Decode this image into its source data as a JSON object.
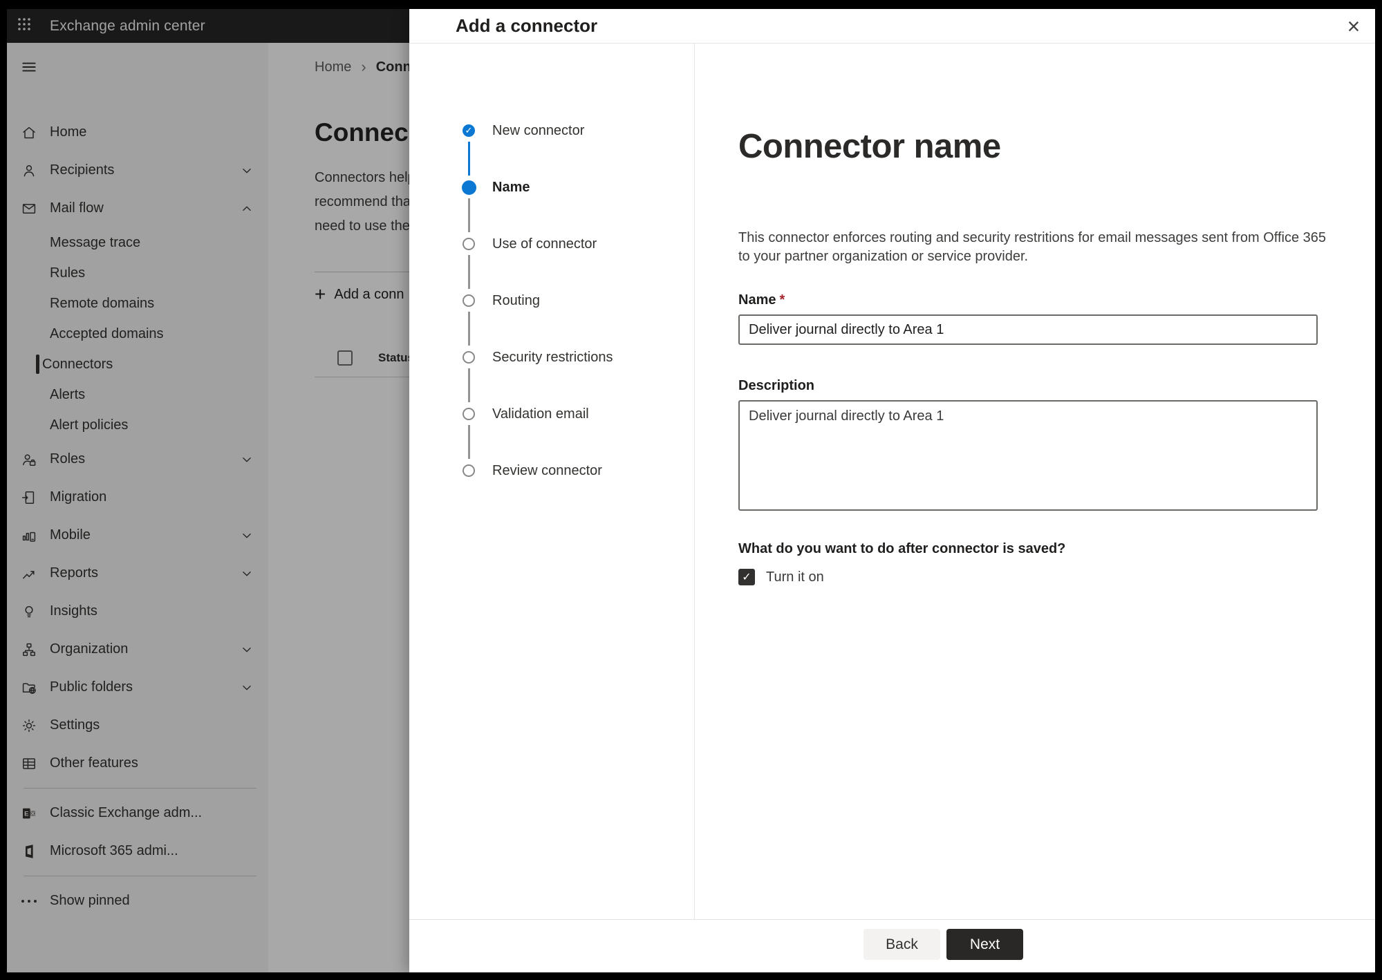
{
  "colors": {
    "accent_blue": "#0b78d4",
    "next_button_bg": "#292827",
    "back_button_bg": "#f3f2f1",
    "required_red": "#a4262c",
    "topbar_bg": "#282726",
    "selected_indicator": "#323130",
    "dim_overlay": "rgba(0,0,0,0.34)"
  },
  "topbar": {
    "app_launcher_icon": "waffle-icon",
    "title": "Exchange admin center"
  },
  "sidebar": {
    "hamburger_icon": "hamburger-icon",
    "items": [
      {
        "label": "Home",
        "icon": "home-icon",
        "type": "top",
        "chevron": null,
        "selected": false
      },
      {
        "label": "Recipients",
        "icon": "person-icon",
        "type": "top",
        "chevron": "down",
        "selected": false
      },
      {
        "label": "Mail flow",
        "icon": "mail-icon",
        "type": "top",
        "chevron": "up",
        "selected": false
      },
      {
        "label": "Message trace",
        "icon": null,
        "type": "sub",
        "chevron": null,
        "selected": false
      },
      {
        "label": "Rules",
        "icon": null,
        "type": "sub",
        "chevron": null,
        "selected": false
      },
      {
        "label": "Remote domains",
        "icon": null,
        "type": "sub",
        "chevron": null,
        "selected": false
      },
      {
        "label": "Accepted domains",
        "icon": null,
        "type": "sub",
        "chevron": null,
        "selected": false
      },
      {
        "label": "Connectors",
        "icon": null,
        "type": "sub",
        "chevron": null,
        "selected": true
      },
      {
        "label": "Alerts",
        "icon": null,
        "type": "sub",
        "chevron": null,
        "selected": false
      },
      {
        "label": "Alert policies",
        "icon": null,
        "type": "sub",
        "chevron": null,
        "selected": false
      },
      {
        "label": "Roles",
        "icon": "roles-icon",
        "type": "top",
        "chevron": "down",
        "selected": false
      },
      {
        "label": "Migration",
        "icon": "migration-icon",
        "type": "top",
        "chevron": null,
        "selected": false
      },
      {
        "label": "Mobile",
        "icon": "mobile-icon",
        "type": "top",
        "chevron": "down",
        "selected": false
      },
      {
        "label": "Reports",
        "icon": "reports-icon",
        "type": "top",
        "chevron": "down",
        "selected": false
      },
      {
        "label": "Insights",
        "icon": "insights-icon",
        "type": "top",
        "chevron": null,
        "selected": false
      },
      {
        "label": "Organization",
        "icon": "organization-icon",
        "type": "top",
        "chevron": "down",
        "selected": false
      },
      {
        "label": "Public folders",
        "icon": "public-folders-icon",
        "type": "top",
        "chevron": "down",
        "selected": false
      },
      {
        "label": "Settings",
        "icon": "settings-icon",
        "type": "top",
        "chevron": null,
        "selected": false
      },
      {
        "label": "Other features",
        "icon": "other-features-icon",
        "type": "top",
        "chevron": null,
        "selected": false
      }
    ],
    "footer_items": [
      {
        "label": "Classic Exchange adm...",
        "icon": "classic-exchange-icon"
      },
      {
        "label": "Microsoft 365 admi...",
        "icon": "m365-icon"
      }
    ],
    "show_pinned": {
      "label": "Show pinned",
      "icon": "ellipsis-icon"
    }
  },
  "page": {
    "breadcrumb": {
      "home": "Home",
      "separator": "›",
      "current": "Conne"
    },
    "title": "Connec",
    "description_lines": [
      "Connectors help",
      "recommend tha",
      "need to use ther"
    ],
    "toolbar": {
      "add_icon": "plus-icon",
      "add_label": "Add a conn"
    },
    "table": {
      "status_header": "Status"
    }
  },
  "modal": {
    "title": "Add a connector",
    "close_icon": "close-icon",
    "steps": [
      {
        "label": "New connector",
        "state": "done"
      },
      {
        "label": "Name",
        "state": "current"
      },
      {
        "label": "Use of connector",
        "state": "upcoming"
      },
      {
        "label": "Routing",
        "state": "upcoming"
      },
      {
        "label": "Security restrictions",
        "state": "upcoming"
      },
      {
        "label": "Validation email",
        "state": "upcoming"
      },
      {
        "label": "Review connector",
        "state": "upcoming"
      }
    ],
    "content": {
      "heading": "Connector name",
      "description_lines": [
        "This connector enforces routing and security restritions for email messages sent from Office 365",
        "to your partner organization or service provider."
      ],
      "name_label": "Name",
      "required_marker": "*",
      "name_value": "Deliver journal directly to Area 1",
      "description_label": "Description",
      "description_value": "Deliver journal directly to Area 1",
      "question": "What do you want to do after connector is saved?",
      "checkbox_checked": true,
      "checkbox_label": "Turn it on",
      "check_glyph": "✓"
    },
    "footer": {
      "back_label": "Back",
      "next_label": "Next"
    }
  }
}
